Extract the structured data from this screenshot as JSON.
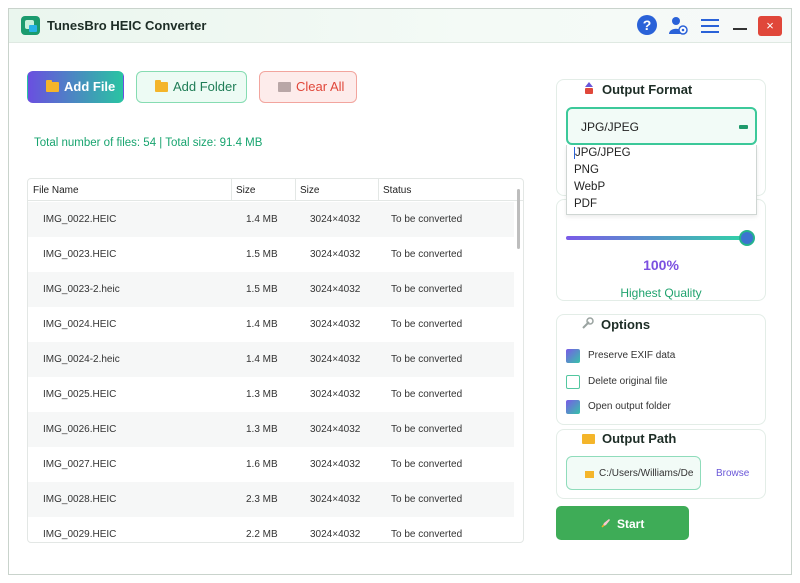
{
  "app": {
    "title": "TunesBro HEIC Converter"
  },
  "titlebar": {
    "close_glyph": "×",
    "help_glyph": "?"
  },
  "toolbar": {
    "add_file": "Add File",
    "add_folder": "Add Folder",
    "clear_all": "Clear All"
  },
  "summary": "Total number of files: 54 | Total size: 91.4 MB",
  "table": {
    "columns": [
      "File Name",
      "Size",
      "Size",
      "Status"
    ],
    "rows": [
      {
        "name": "IMG_0022.HEIC",
        "size": "1.4 MB",
        "dims": "3024×4032",
        "status": "To be converted"
      },
      {
        "name": "IMG_0023.HEIC",
        "size": "1.5 MB",
        "dims": "3024×4032",
        "status": "To be converted"
      },
      {
        "name": "IMG_0023-2.heic",
        "size": "1.5 MB",
        "dims": "3024×4032",
        "status": "To be converted"
      },
      {
        "name": "IMG_0024.HEIC",
        "size": "1.4 MB",
        "dims": "3024×4032",
        "status": "To be converted"
      },
      {
        "name": "IMG_0024-2.heic",
        "size": "1.4 MB",
        "dims": "3024×4032",
        "status": "To be converted"
      },
      {
        "name": "IMG_0025.HEIC",
        "size": "1.3 MB",
        "dims": "3024×4032",
        "status": "To be converted"
      },
      {
        "name": "IMG_0026.HEIC",
        "size": "1.3 MB",
        "dims": "3024×4032",
        "status": "To be converted"
      },
      {
        "name": "IMG_0027.HEIC",
        "size": "1.6 MB",
        "dims": "3024×4032",
        "status": "To be converted"
      },
      {
        "name": "IMG_0028.HEIC",
        "size": "2.3 MB",
        "dims": "3024×4032",
        "status": "To be converted"
      },
      {
        "name": "IMG_0029.HEIC",
        "size": "2.2 MB",
        "dims": "3024×4032",
        "status": "To be converted"
      }
    ]
  },
  "output_format": {
    "title": "Output Format",
    "selected": "JPG/JPEG",
    "options": [
      "JPG/JPEG",
      "PNG",
      "WebP",
      "PDF"
    ]
  },
  "quality": {
    "value_label": "100%",
    "value": 1.0,
    "label": "Highest Quality"
  },
  "options": {
    "title": "Options",
    "items": [
      {
        "label": "Preserve EXIF data",
        "checked": true
      },
      {
        "label": "Delete original file",
        "checked": false
      },
      {
        "label": "Open output folder",
        "checked": true
      }
    ]
  },
  "output_path": {
    "title": "Output Path",
    "path": "C:/Users/Williams/De",
    "browse": "Browse"
  },
  "start": {
    "label": "Start"
  },
  "colors": {
    "accent_green": "#3eac57",
    "accent_purple": "#7b4fe0",
    "close_red": "#e0473a"
  }
}
